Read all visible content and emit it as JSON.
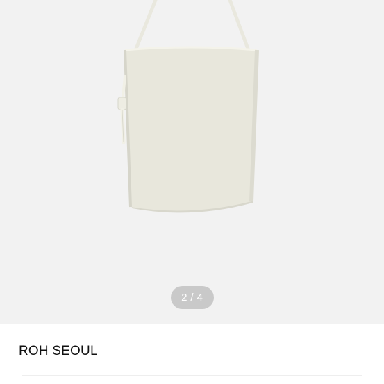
{
  "gallery": {
    "image_icon": "product-photo-bucket-bag",
    "background_color": "#f2f2f2",
    "bag_color": "#e8e7dc",
    "pager": {
      "current": "2",
      "separator": "/",
      "total": "4"
    }
  },
  "product": {
    "brand": "ROH SEOUL"
  }
}
